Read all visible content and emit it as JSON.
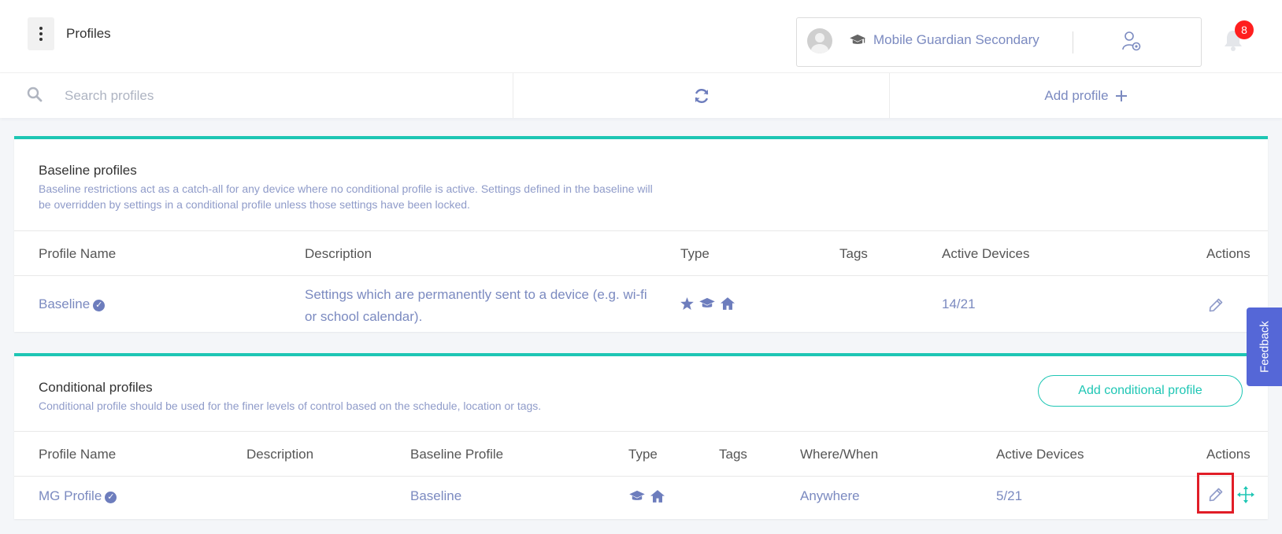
{
  "header": {
    "title": "Profiles",
    "school_name": "Mobile Guardian Secondary",
    "notification_count": "8"
  },
  "actionbar": {
    "search_placeholder": "Search profiles",
    "add_profile_label": "Add profile"
  },
  "baseline": {
    "title": "Baseline profiles",
    "description": "Baseline restrictions act as a catch-all for any device where no conditional profile is active. Settings defined in the baseline will be overridden by settings in a conditional profile unless those settings have been locked.",
    "columns": {
      "name": "Profile Name",
      "description": "Description",
      "type": "Type",
      "tags": "Tags",
      "active_devices": "Active Devices",
      "actions": "Actions"
    },
    "rows": [
      {
        "name": "Baseline",
        "description": "Settings which are permanently sent to a device (e.g. wi-fi or school calendar).",
        "type_icons": [
          "star-icon",
          "graduation-cap-icon",
          "home-icon"
        ],
        "tags": "",
        "active_devices": "14/21"
      }
    ]
  },
  "conditional": {
    "title": "Conditional profiles",
    "description": "Conditional profile should be used for the finer levels of control based on the schedule, location or tags.",
    "add_button_label": "Add conditional profile",
    "columns": {
      "name": "Profile Name",
      "description": "Description",
      "baseline_profile": "Baseline Profile",
      "type": "Type",
      "tags": "Tags",
      "where_when": "Where/When",
      "active_devices": "Active Devices",
      "actions": "Actions"
    },
    "rows": [
      {
        "name": "MG Profile",
        "description": "",
        "baseline_profile": "Baseline",
        "type_icons": [
          "graduation-cap-icon",
          "home-icon"
        ],
        "tags": "",
        "where_when": "Anywhere",
        "active_devices": "5/21"
      }
    ]
  },
  "feedback_label": "Feedback",
  "colors": {
    "accent": "#1ec6b4",
    "link": "#7b8ac0",
    "highlight": "#e11d27",
    "feedback": "#5567d7",
    "badge": "#ff1f1f"
  }
}
